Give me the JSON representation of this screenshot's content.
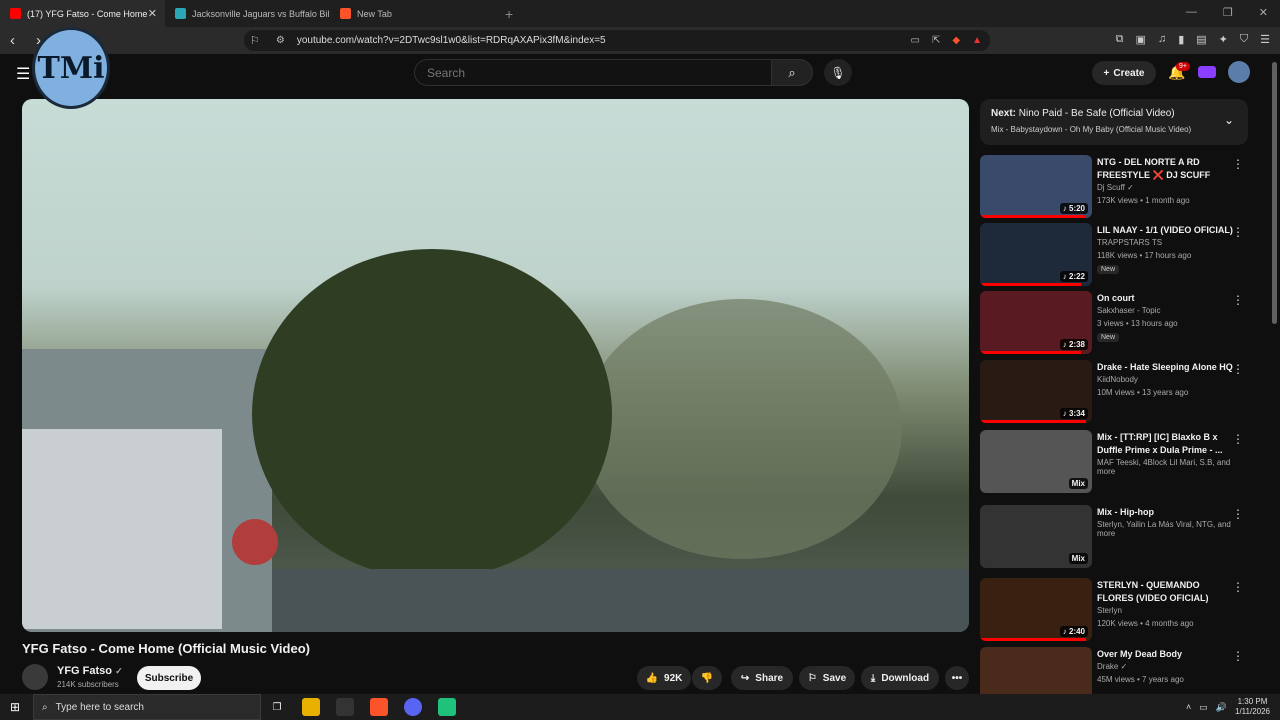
{
  "browser": {
    "tabs": [
      {
        "title": "(17) YFG Fatso - Come Home",
        "color": "#ff0000",
        "active": true
      },
      {
        "title": "Jacksonville Jaguars vs Buffalo Bills",
        "color": "#2aa8b8",
        "active": false
      },
      {
        "title": "New Tab",
        "color": "#fb542b",
        "active": false
      }
    ],
    "url": "youtube.com/watch?v=2DTwc9sl1w0&list=RDRqAXAPix3fM&index=5"
  },
  "yt": {
    "logo_text": "TMi",
    "search_placeholder": "Search",
    "create_label": "Create",
    "notif_badge": "9+",
    "video": {
      "title": "YFG Fatso - Come Home (Official Music Video)"
    },
    "channel": {
      "name": "YFG Fatso",
      "subs": "214K subscribers",
      "subscribe": "Subscribe"
    },
    "actions": {
      "likes": "92K",
      "share": "Share",
      "save": "Save",
      "download": "Download"
    },
    "upnext": {
      "next_label": "Next:",
      "next_title": "Nino Paid - Be Safe (Official Video)",
      "mix": "Mix - Babystaydown - Oh My Baby (Official Music Video)"
    },
    "recs": [
      {
        "title": "NTG - DEL NORTE A RD FREESTYLE ❌ DJ SCUFF",
        "channel": "Dj Scuff ✓",
        "views": "173K views • 1 month ago",
        "dur": "♪ 5:20",
        "color": "#3a4a6a",
        "progress": 0.95,
        "isnew": false
      },
      {
        "title": "LIL NAAY - 1/1 (VIDEO OFICIAL)",
        "channel": "TRAPPSTARS TS",
        "views": "118K views • 17 hours ago",
        "dur": "♪ 2:22",
        "color": "#1e2a3a",
        "progress": 0.9,
        "isnew": true,
        "newlabel": "New"
      },
      {
        "title": "On court",
        "channel": "Sakxhaser - Topic",
        "views": "3 views • 13 hours ago",
        "dur": "♪ 2:38",
        "color": "#5a1a22",
        "progress": 0.9,
        "isnew": true,
        "newlabel": "New"
      },
      {
        "title": "Drake - Hate Sleeping Alone HQ",
        "channel": "KiidNobody",
        "views": "10M views • 13 years ago",
        "dur": "♪ 3:34",
        "color": "#2a1a14",
        "progress": 0.95,
        "isnew": false
      },
      {
        "title": "Mix - [TT:RP] [IC] Blaxko B x Duffle Prime x Dula Prime - ...",
        "channel": "MAF Teeski, 4Block Lil Mari, S.B, and more",
        "views": "",
        "dur": "Mix",
        "color": "#555",
        "progress": 0,
        "isnew": false
      },
      {
        "title": "Mix - Hip-hop",
        "channel": "Sterlyn, Yailin La Más Viral, NTG, and more",
        "views": "",
        "dur": "Mix",
        "color": "#333",
        "progress": 0,
        "isnew": false
      },
      {
        "title": "STERLYN - QUEMANDO FLORES (VIDEO OFICIAL)",
        "channel": "Sterlyn",
        "views": "120K views • 4 months ago",
        "dur": "♪ 2:40",
        "color": "#3a2010",
        "progress": 0.95,
        "isnew": false
      },
      {
        "title": "Over My Dead Body",
        "channel": "Drake ✓",
        "views": "45M views • 7 years ago",
        "dur": "",
        "color": "#4a2a1a",
        "progress": 0,
        "isnew": false
      }
    ]
  },
  "taskbar": {
    "search": "Type here to search",
    "time": "1:30 PM",
    "date": "1/11/2026"
  }
}
